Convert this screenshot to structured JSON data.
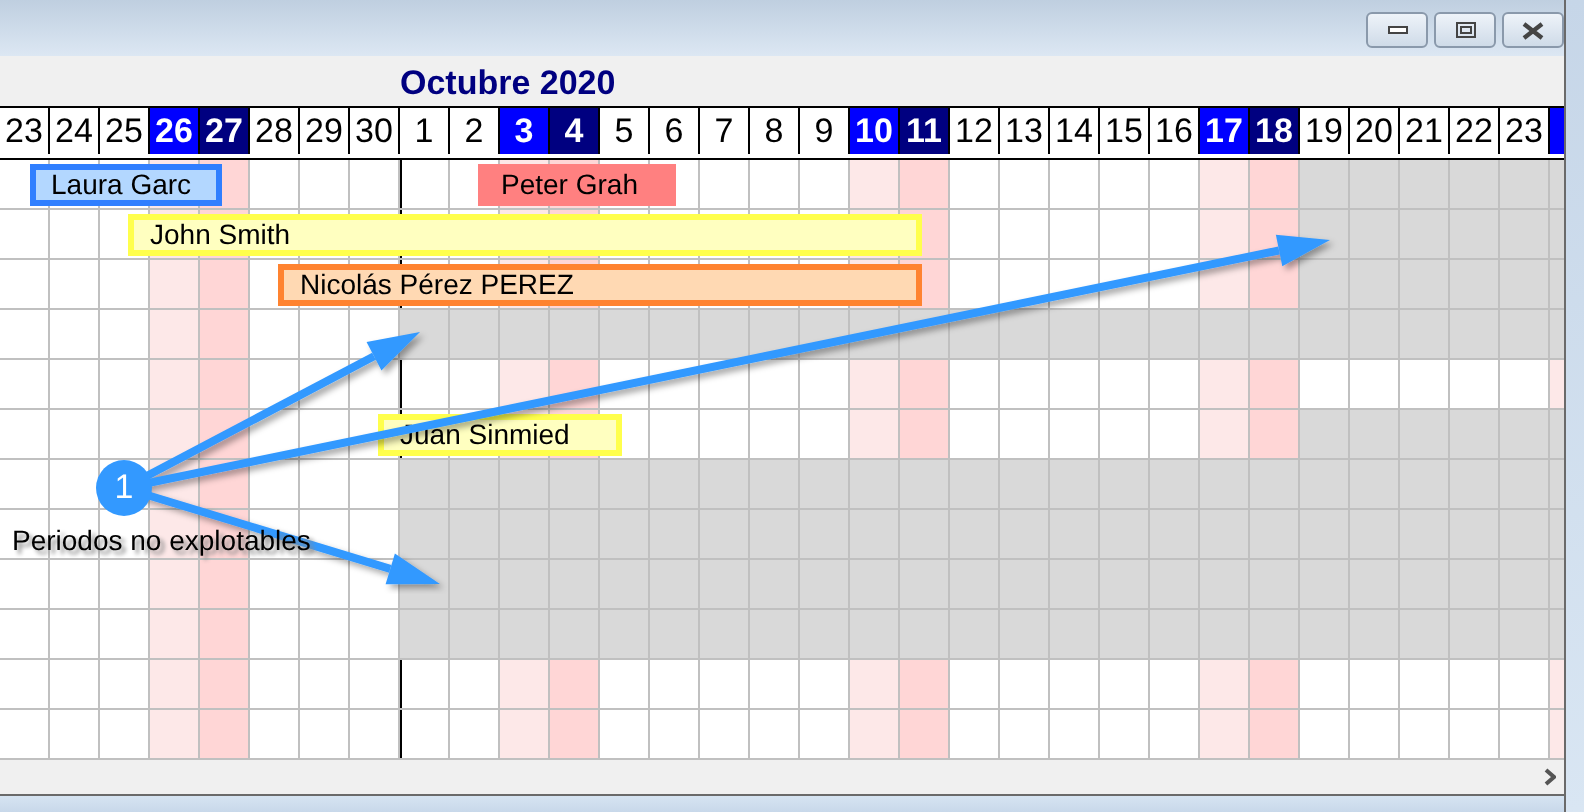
{
  "window": {
    "controls": [
      {
        "kind": "minimize"
      },
      {
        "kind": "maximize"
      },
      {
        "kind": "close"
      }
    ]
  },
  "calendar": {
    "month_title": "Octubre 2020",
    "days": [
      {
        "label": "23",
        "kind": "weekday"
      },
      {
        "label": "24",
        "kind": "weekday"
      },
      {
        "label": "25",
        "kind": "weekday"
      },
      {
        "label": "26",
        "kind": "saturday"
      },
      {
        "label": "27",
        "kind": "sunday"
      },
      {
        "label": "28",
        "kind": "weekday"
      },
      {
        "label": "29",
        "kind": "weekday"
      },
      {
        "label": "30",
        "kind": "weekday"
      },
      {
        "label": "1",
        "kind": "weekday",
        "month_start": true
      },
      {
        "label": "2",
        "kind": "weekday"
      },
      {
        "label": "3",
        "kind": "saturday"
      },
      {
        "label": "4",
        "kind": "sunday"
      },
      {
        "label": "5",
        "kind": "weekday"
      },
      {
        "label": "6",
        "kind": "weekday"
      },
      {
        "label": "7",
        "kind": "weekday"
      },
      {
        "label": "8",
        "kind": "weekday"
      },
      {
        "label": "9",
        "kind": "weekday"
      },
      {
        "label": "10",
        "kind": "saturday"
      },
      {
        "label": "11",
        "kind": "sunday"
      },
      {
        "label": "12",
        "kind": "weekday"
      },
      {
        "label": "13",
        "kind": "weekday"
      },
      {
        "label": "14",
        "kind": "weekday"
      },
      {
        "label": "15",
        "kind": "weekday"
      },
      {
        "label": "16",
        "kind": "weekday"
      },
      {
        "label": "17",
        "kind": "saturday"
      },
      {
        "label": "18",
        "kind": "sunday"
      },
      {
        "label": "19",
        "kind": "weekday"
      },
      {
        "label": "20",
        "kind": "weekday"
      },
      {
        "label": "21",
        "kind": "weekday"
      },
      {
        "label": "22",
        "kind": "weekday"
      },
      {
        "label": "23",
        "kind": "weekday"
      },
      {
        "kind": "saturday"
      }
    ],
    "rows": [
      {
        "unavailable": [
          false,
          false,
          false,
          false,
          false,
          false,
          false,
          false,
          false,
          false,
          false,
          false,
          false,
          false,
          false,
          false,
          false,
          false,
          false,
          false,
          false,
          false,
          false,
          false,
          false,
          false,
          true,
          true,
          true,
          true,
          true,
          true
        ],
        "bars": [
          {
            "name": "Laura Garc",
            "kind": "framed",
            "color": "#b3d7ff"
          },
          {
            "name": "Peter Grah",
            "kind": "plain",
            "color": "#ff8080"
          }
        ]
      },
      {
        "unavailable": [
          false,
          false,
          false,
          false,
          false,
          false,
          false,
          false,
          false,
          false,
          false,
          false,
          false,
          false,
          false,
          false,
          false,
          false,
          false,
          false,
          false,
          false,
          false,
          false,
          false,
          false,
          true,
          true,
          true,
          true,
          true,
          true
        ],
        "bars": [
          {
            "name": "John Smith",
            "kind": "framed",
            "color": "#ffffc0"
          }
        ]
      },
      {
        "unavailable": [
          false,
          false,
          false,
          false,
          false,
          false,
          false,
          false,
          false,
          false,
          false,
          false,
          false,
          false,
          false,
          false,
          false,
          false,
          false,
          false,
          false,
          false,
          false,
          false,
          false,
          false,
          true,
          true,
          true,
          true,
          true,
          true
        ],
        "bars": [
          {
            "name": "Nicolás Pérez PEREZ",
            "kind": "framed",
            "color": "#ffd9b3"
          }
        ]
      },
      {
        "unavailable": [
          false,
          false,
          false,
          false,
          false,
          false,
          false,
          false,
          true,
          true,
          true,
          true,
          true,
          true,
          true,
          true,
          true,
          true,
          true,
          true,
          true,
          true,
          true,
          true,
          true,
          true,
          true,
          true,
          true,
          true,
          true,
          true
        ]
      },
      {
        "unavailable": [
          false,
          false,
          false,
          false,
          false,
          false,
          false,
          false,
          false,
          false,
          false,
          false,
          false,
          false,
          false,
          false,
          false,
          false,
          false,
          false,
          false,
          false,
          false,
          false,
          false,
          false,
          false,
          false,
          false,
          false,
          false,
          false
        ]
      },
      {
        "unavailable": [
          false,
          false,
          false,
          false,
          false,
          false,
          false,
          false,
          false,
          false,
          false,
          false,
          false,
          false,
          false,
          false,
          false,
          false,
          false,
          false,
          false,
          false,
          false,
          false,
          false,
          false,
          true,
          true,
          true,
          true,
          true,
          true
        ],
        "bars": [
          {
            "name": "Juan Sinmied",
            "kind": "framed",
            "color": "#ffffc0"
          }
        ]
      },
      {
        "unavailable": [
          false,
          false,
          false,
          false,
          false,
          false,
          false,
          false,
          true,
          true,
          true,
          true,
          true,
          true,
          true,
          true,
          true,
          true,
          true,
          true,
          true,
          true,
          true,
          true,
          true,
          true,
          true,
          true,
          true,
          true,
          true,
          true
        ]
      },
      {
        "unavailable": [
          false,
          false,
          false,
          false,
          false,
          false,
          false,
          false,
          true,
          true,
          true,
          true,
          true,
          true,
          true,
          true,
          true,
          true,
          true,
          true,
          true,
          true,
          true,
          true,
          true,
          true,
          true,
          true,
          true,
          true,
          true,
          true
        ]
      },
      {
        "unavailable": [
          false,
          false,
          false,
          false,
          false,
          false,
          false,
          false,
          true,
          true,
          true,
          true,
          true,
          true,
          true,
          true,
          true,
          true,
          true,
          true,
          true,
          true,
          true,
          true,
          true,
          true,
          true,
          true,
          true,
          true,
          true,
          true
        ]
      },
      {
        "unavailable": [
          false,
          false,
          false,
          false,
          false,
          false,
          false,
          false,
          true,
          true,
          true,
          true,
          true,
          true,
          true,
          true,
          true,
          true,
          true,
          true,
          true,
          true,
          true,
          true,
          true,
          true,
          true,
          true,
          true,
          true,
          true,
          true
        ]
      },
      {
        "unavailable": [
          false,
          false,
          false,
          false,
          false,
          false,
          false,
          false,
          false,
          false,
          false,
          false,
          false,
          false,
          false,
          false,
          false,
          false,
          false,
          false,
          false,
          false,
          false,
          false,
          false,
          false,
          false,
          false,
          false,
          false,
          false,
          false
        ]
      },
      {
        "unavailable": [
          false,
          false,
          false,
          false,
          false,
          false,
          false,
          false,
          false,
          false,
          false,
          false,
          false,
          false,
          false,
          false,
          false,
          false,
          false,
          false,
          false,
          false,
          false,
          false,
          false,
          false,
          false,
          false,
          false,
          false,
          false,
          false
        ]
      }
    ]
  },
  "callout": {
    "number": "1",
    "label": "Periodos no explotables"
  }
}
